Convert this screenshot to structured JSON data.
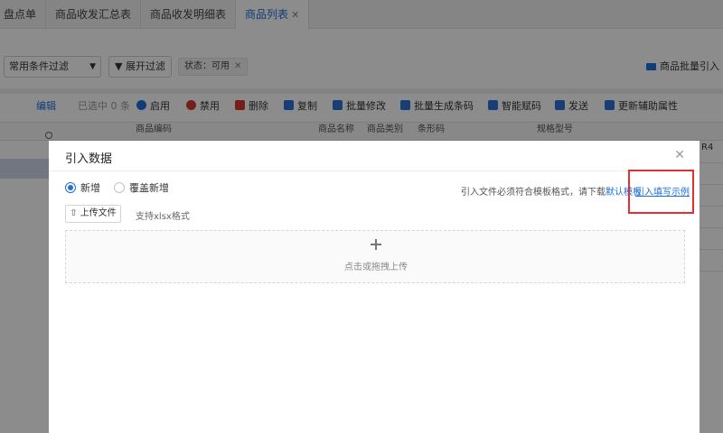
{
  "tabs": [
    {
      "label": "盘点单",
      "active": false,
      "closable": false
    },
    {
      "label": "商品收发汇总表",
      "active": false,
      "closable": false
    },
    {
      "label": "商品收发明细表",
      "active": false,
      "closable": false
    },
    {
      "label": "商品列表",
      "active": true,
      "closable": true
    }
  ],
  "filter": {
    "select_value": "常用条件过滤",
    "expand_label": "展开过滤",
    "status_tag": "状态：可用",
    "batch_import": "商品批量引入"
  },
  "toolbar": {
    "edit": "编辑",
    "selected": "已选中 0 条",
    "enable": "启用",
    "disable": "禁用",
    "delete": "删除",
    "copy": "复制",
    "batch_edit": "批量修改",
    "batch_barcode": "批量生成条码",
    "smart_code": "智能赋码",
    "send": "发送",
    "update_attr": "更新辅助属性"
  },
  "table": {
    "columns": [
      "商品编码",
      "商品名称",
      "商品类别",
      "条形码",
      "规格型号"
    ],
    "partial_cell": "R4"
  },
  "modal": {
    "title": "引入数据",
    "radio_new": "新增",
    "radio_overwrite": "覆盖新增",
    "hint_text": "引入文件必须符合模板格式，请下载",
    "default_template": "默认模板",
    "example_link": "引入填写示例",
    "upload_button": "上传文件",
    "upload_note": "支持xlsx格式",
    "drop_text": "点击或拖拽上传"
  },
  "colors": {
    "accent": "#1e6fd9",
    "highlight_box": "#e03131",
    "danger": "#d73a2f"
  }
}
